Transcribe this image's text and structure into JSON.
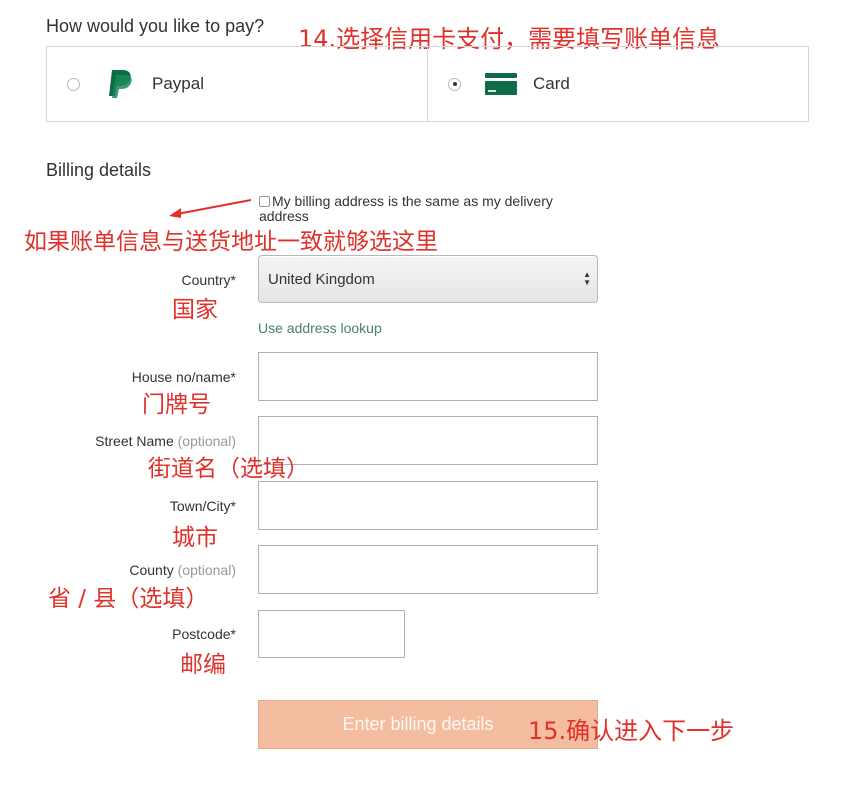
{
  "payment": {
    "question": "How would you like to pay?",
    "options": [
      {
        "label": "Paypal",
        "icon": "paypal-icon",
        "selected": false
      },
      {
        "label": "Card",
        "icon": "credit-card-icon",
        "selected": true
      }
    ]
  },
  "billing": {
    "title": "Billing details",
    "same_address_checkbox": {
      "label": "My billing address is the same as my delivery address",
      "checked": false
    },
    "country": {
      "label": "Country*",
      "value": "United Kingdom"
    },
    "address_lookup_link": "Use address lookup",
    "fields": {
      "house": {
        "label": "House no/name*",
        "value": ""
      },
      "street": {
        "label": "Street Name",
        "optional": "(optional)",
        "value": ""
      },
      "town": {
        "label": "Town/City*",
        "value": ""
      },
      "county": {
        "label": "County",
        "optional": "(optional)",
        "value": ""
      },
      "postcode": {
        "label": "Postcode*",
        "value": ""
      }
    },
    "submit_label": "Enter billing details"
  },
  "annotations": {
    "step14": "14.选择信用卡支付，需要填写账单信息",
    "same_address": "如果账单信息与送货地址一致就够选这里",
    "country": "国家",
    "house": "门牌号",
    "street": "街道名（选填）",
    "town": "城市",
    "county": "省 / 县（选填）",
    "postcode": "邮编",
    "step15": "15.确认进入下一步"
  },
  "colors": {
    "brand_green": "#0f6b45",
    "button_bg": "#f5bda0",
    "link": "#4a8070",
    "annotation_red": "#e0312b"
  }
}
